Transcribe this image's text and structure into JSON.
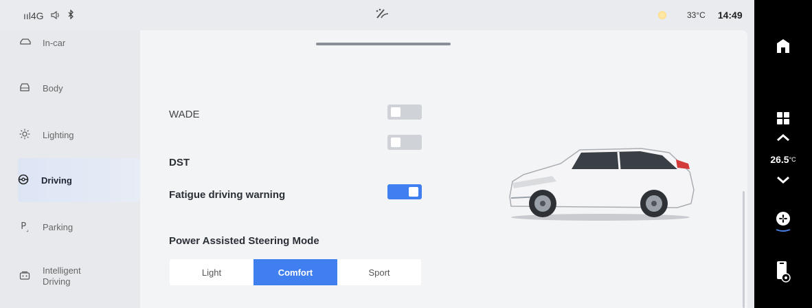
{
  "status_bar": {
    "signal": "ııl4G",
    "volume_icon": "volume-icon",
    "bluetooth_icon": "bluetooth-icon",
    "center_icon": "wiper-icon",
    "temperature": "33°C",
    "time": "14:49"
  },
  "sidebar": {
    "items": [
      {
        "label": "In-car",
        "icon": "car-outline-icon"
      },
      {
        "label": "Body",
        "icon": "car-body-icon"
      },
      {
        "label": "Lighting",
        "icon": "light-icon"
      },
      {
        "label": "Driving",
        "icon": "steering-wheel-icon",
        "active": true
      },
      {
        "label": "Parking",
        "icon": "parking-icon"
      },
      {
        "label": "Intelligent Driving",
        "icon": "camera-icon"
      }
    ]
  },
  "settings": {
    "wade": {
      "label": "WADE",
      "on": false
    },
    "dst": {
      "label": "DST",
      "on": false
    },
    "fatigue": {
      "label": "Fatigue driving warning",
      "on": true
    },
    "steering": {
      "label": "Power Assisted Steering Mode",
      "options": [
        "Light",
        "Comfort",
        "Sport"
      ],
      "selected": "Comfort"
    }
  },
  "dock": {
    "home_icon": "home-icon",
    "apps_icon": "apps-grid-icon",
    "up_icon": "chevron-up-icon",
    "temp_value": "26.5",
    "temp_unit": "°C",
    "down_icon": "chevron-down-icon",
    "fan_icon": "fan-icon",
    "phone_icon": "phone-settings-icon"
  },
  "colors": {
    "accent": "#3f7ff0",
    "background": "#f3f4f6",
    "dock": "#000000"
  }
}
